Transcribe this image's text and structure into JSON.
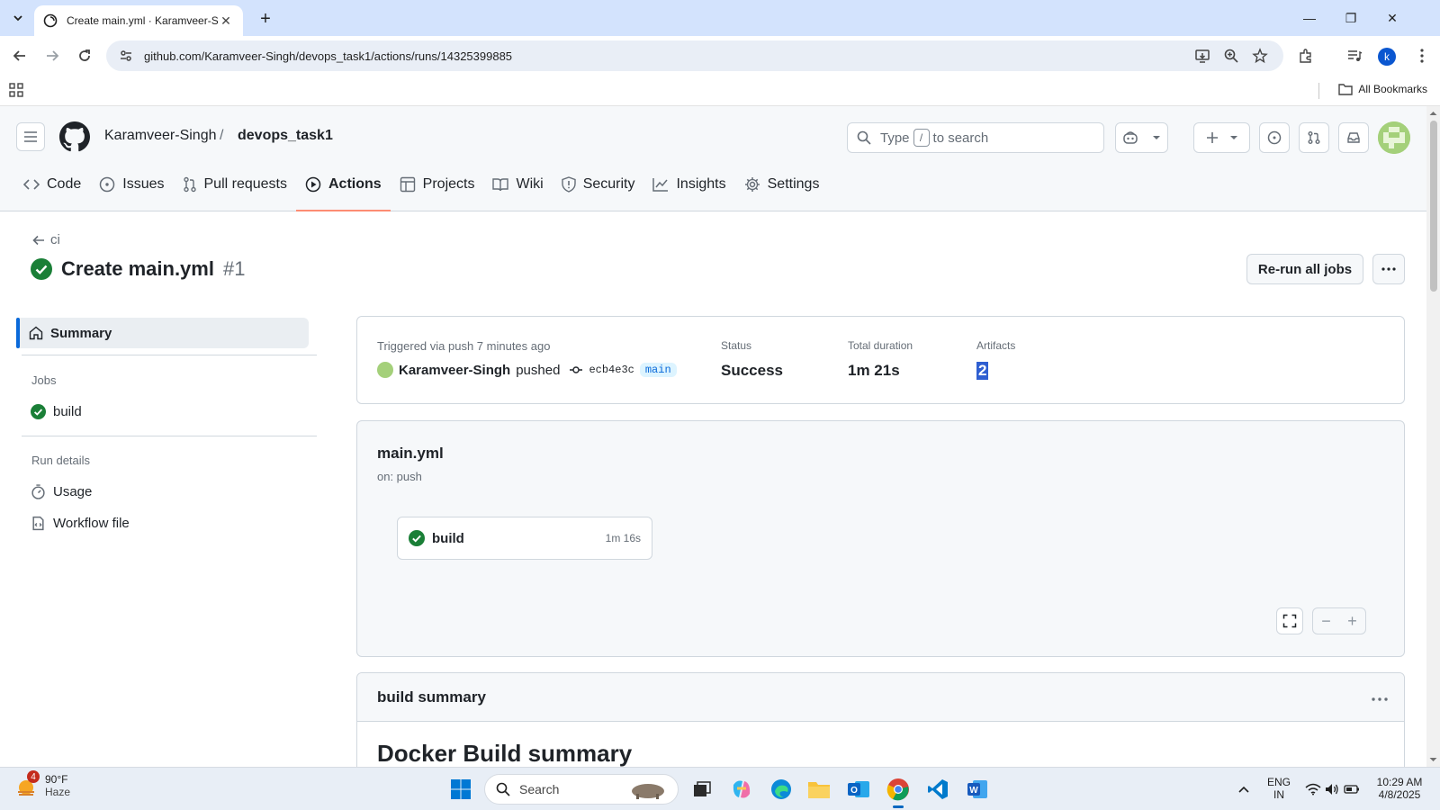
{
  "browser": {
    "tab_title": "Create main.yml · Karamveer-Si",
    "url": "github.com/Karamveer-Singh/devops_task1/actions/runs/14325399885",
    "profile_initial": "k",
    "all_bookmarks": "All Bookmarks"
  },
  "header": {
    "owner": "Karamveer-Singh",
    "separator": "/",
    "repo": "devops_task1",
    "search_prefix": "Type",
    "search_key": "/",
    "search_suffix": "to search"
  },
  "repo_nav": [
    {
      "label": "Code",
      "icon": "code-icon"
    },
    {
      "label": "Issues",
      "icon": "issue-icon"
    },
    {
      "label": "Pull requests",
      "icon": "pull-request-icon"
    },
    {
      "label": "Actions",
      "icon": "play-icon",
      "active": true
    },
    {
      "label": "Projects",
      "icon": "table-icon"
    },
    {
      "label": "Wiki",
      "icon": "book-icon"
    },
    {
      "label": "Security",
      "icon": "shield-icon"
    },
    {
      "label": "Insights",
      "icon": "graph-icon"
    },
    {
      "label": "Settings",
      "icon": "gear-icon"
    }
  ],
  "run": {
    "back_label": "ci",
    "title": "Create main.yml",
    "number": "#1",
    "rerun_label": "Re-run all jobs"
  },
  "sidebar": {
    "summary": "Summary",
    "jobs_heading": "Jobs",
    "job": "build",
    "details_heading": "Run details",
    "usage": "Usage",
    "workflow_file": "Workflow file"
  },
  "summary": {
    "trigger_label": "Triggered via push 7 minutes ago",
    "actor": "Karamveer-Singh",
    "action": "pushed",
    "sha": "ecb4e3c",
    "branch": "main",
    "status_label": "Status",
    "status_value": "Success",
    "duration_label": "Total duration",
    "duration_value": "1m 21s",
    "artifacts_label": "Artifacts",
    "artifacts_value": "2"
  },
  "workflow": {
    "name": "main.yml",
    "trigger": "on: push",
    "job_name": "build",
    "job_duration": "1m 16s"
  },
  "build_summary": {
    "title": "build summary",
    "heading": "Docker Build summary"
  },
  "taskbar": {
    "weather_badge": "4",
    "temperature": "90°F",
    "condition": "Haze",
    "search_label": "Search",
    "lang_top": "ENG",
    "lang_bottom": "IN",
    "time": "10:29 AM",
    "date": "4/8/2025"
  },
  "colors": {
    "success": "#1a7f37",
    "accent": "#0969da",
    "active_underline": "#fd8c73"
  }
}
